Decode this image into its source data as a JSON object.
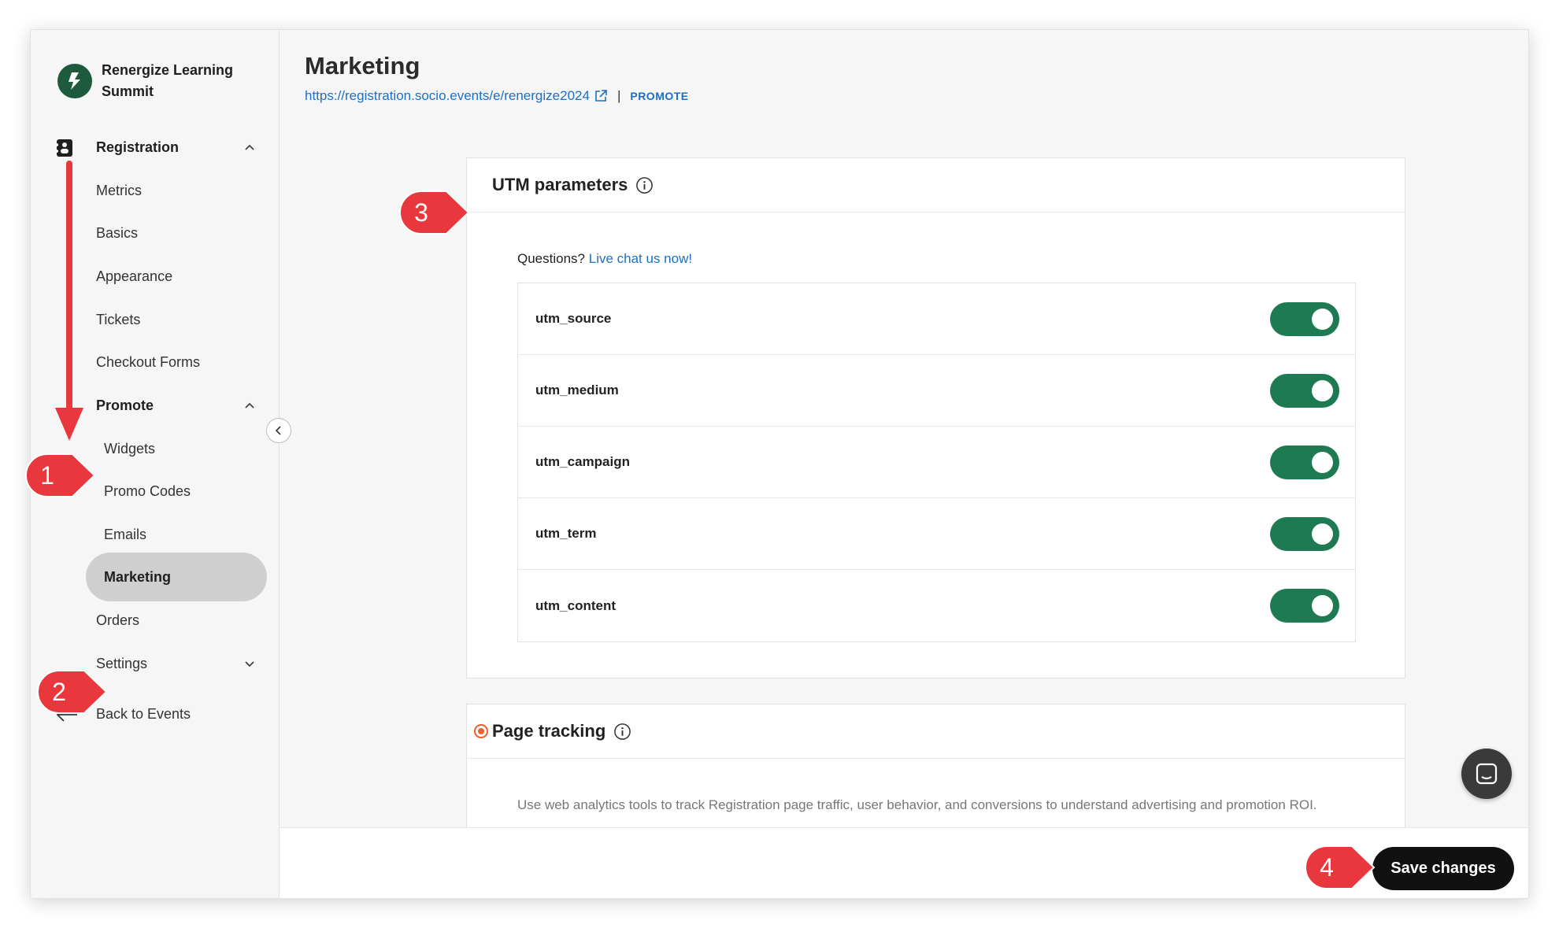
{
  "brand": {
    "name": "Renergize Learning Summit"
  },
  "sidebar": {
    "items": [
      {
        "label": "Registration"
      },
      {
        "label": "Metrics"
      },
      {
        "label": "Basics"
      },
      {
        "label": "Appearance"
      },
      {
        "label": "Tickets"
      },
      {
        "label": "Checkout Forms"
      },
      {
        "label": "Promote"
      },
      {
        "label": "Widgets"
      },
      {
        "label": "Promo Codes"
      },
      {
        "label": "Emails"
      },
      {
        "label": "Marketing"
      },
      {
        "label": "Orders"
      },
      {
        "label": "Settings"
      }
    ],
    "back_label": "Back to Events"
  },
  "header": {
    "title": "Marketing",
    "url": "https://registration.socio.events/e/renergize2024",
    "separator": "|",
    "promote_label": "PROMOTE"
  },
  "utm": {
    "title": "UTM parameters",
    "questions": "Questions?",
    "chat_link": "Live chat us now!",
    "params": [
      {
        "name": "utm_source",
        "enabled": true
      },
      {
        "name": "utm_medium",
        "enabled": true
      },
      {
        "name": "utm_campaign",
        "enabled": true
      },
      {
        "name": "utm_term",
        "enabled": true
      },
      {
        "name": "utm_content",
        "enabled": true
      }
    ]
  },
  "tracking": {
    "title": "Page tracking",
    "description": "Use web analytics tools to track Registration page traffic, user behavior, and conversions to understand advertising and promotion ROI."
  },
  "footer": {
    "save_label": "Save changes"
  },
  "annotations": {
    "1": "1",
    "2": "2",
    "3": "3",
    "4": "4"
  },
  "colors": {
    "accent": "#1e7a52",
    "link": "#1c6fc4",
    "annotation": "#e8383d"
  }
}
